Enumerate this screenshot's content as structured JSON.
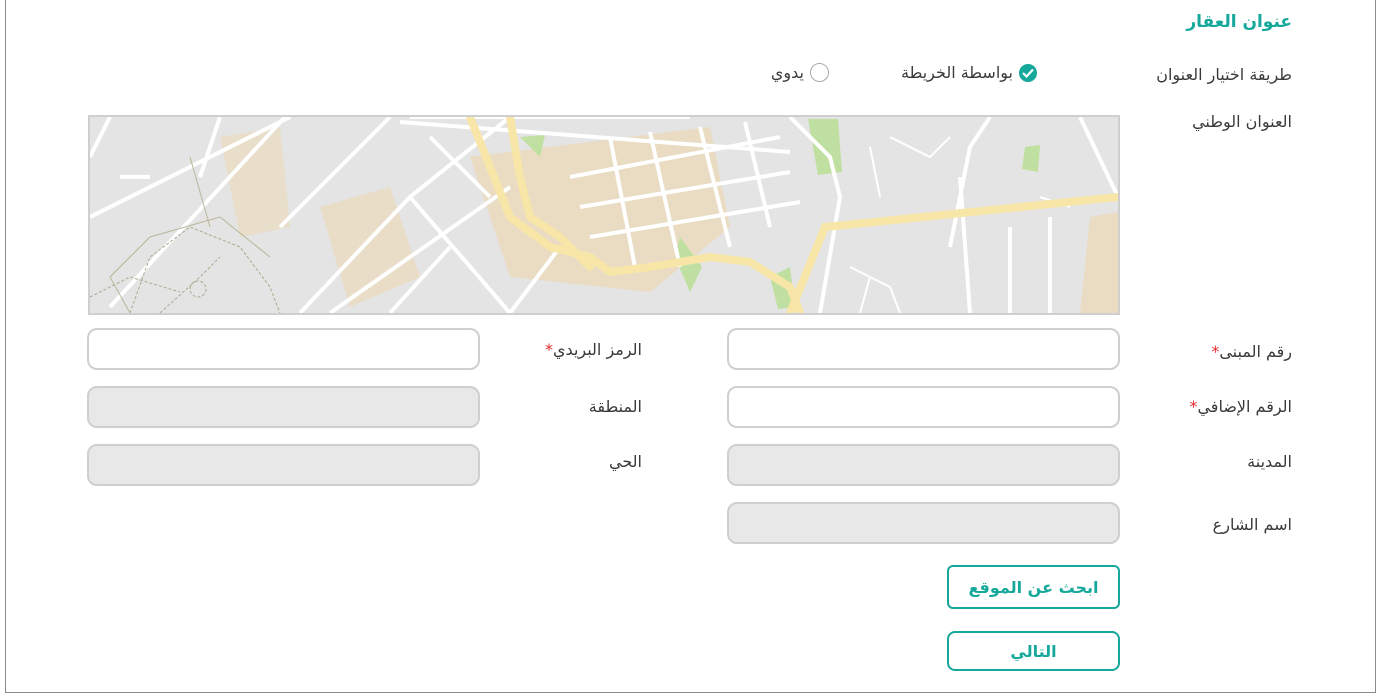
{
  "section_title": "عنوان العقار",
  "method": {
    "label": "طريقة اختيار العنوان",
    "options": [
      {
        "label": "بواسطة الخريطة",
        "selected": true
      },
      {
        "label": "يدوي",
        "selected": false
      }
    ]
  },
  "national_address_label": "العنوان الوطني",
  "fields": {
    "building_number": {
      "label": "رقم المبنى",
      "required_mark": "*",
      "value": ""
    },
    "postal_code": {
      "label": "الرمز البريدي",
      "required_mark": "*",
      "value": ""
    },
    "additional_number": {
      "label": "الرقم الإضافي",
      "required_mark": "*",
      "value": ""
    },
    "region": {
      "label": "المنطقة",
      "value": ""
    },
    "city": {
      "label": "المدينة",
      "value": ""
    },
    "district": {
      "label": "الحي",
      "value": ""
    },
    "street_name": {
      "label": "اسم الشارع",
      "value": ""
    }
  },
  "buttons": {
    "search_location": "ابحث عن الموقع",
    "next": "التالي"
  },
  "colors": {
    "accent": "#15a89b",
    "required": "#e0282e",
    "map_road_major": "#f7e6a8",
    "map_park": "#bfe0a0",
    "map_block": "#e9dcc3"
  }
}
